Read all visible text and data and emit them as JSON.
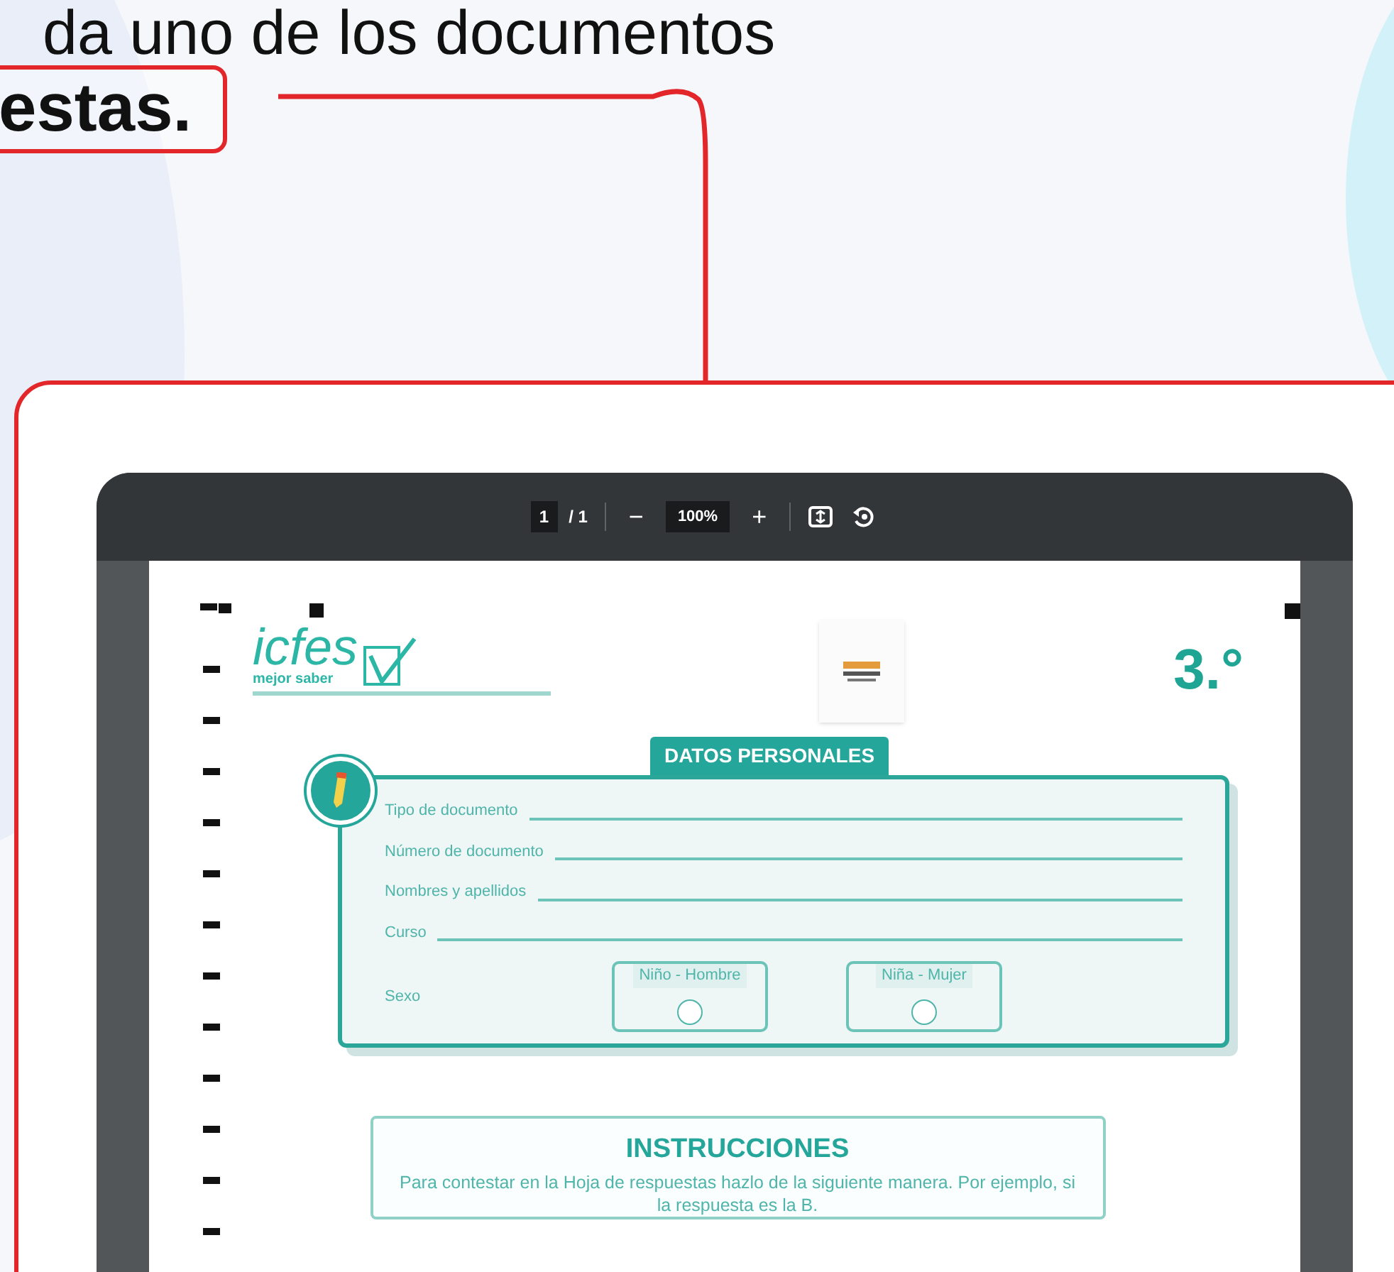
{
  "heading": {
    "line_1": "da uno de los documentos",
    "line_2": "estas."
  },
  "viewer": {
    "page_current": "1",
    "page_total": "/ 1",
    "zoom_out": "−",
    "zoom": "100%",
    "zoom_in": "+"
  },
  "document": {
    "logo": {
      "name": "icfes",
      "tagline": "mejor saber"
    },
    "grade": "3.°",
    "personal_data": {
      "title": "DATOS PERSONALES",
      "fields": [
        "Tipo de documento",
        "Número de documento",
        "Nombres y apellidos",
        "Curso"
      ],
      "sex_label": "Sexo",
      "sex_options": [
        {
          "label": "Niño - Hombre",
          "selected": false
        },
        {
          "label": "Niña - Mujer",
          "selected": false
        }
      ]
    },
    "instructions": {
      "title": "INSTRUCCIONES",
      "text": "Para contestar en la Hoja de respuestas hazlo de la siguiente manera. Por ejemplo, si la respuesta es la B."
    }
  }
}
